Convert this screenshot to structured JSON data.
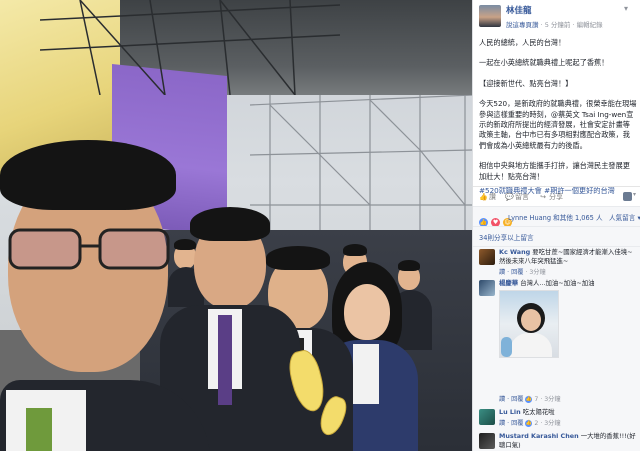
{
  "post": {
    "author": "林佳龍",
    "meta_verified": "說這專頁讚",
    "meta_time": "5 分鐘前",
    "meta_edited": "編輯紀錄",
    "body": [
      "人民的總統，人民的台灣！",
      "",
      "一起在小英總統就職典禮上呢起了香蕉！",
      "",
      "【迎接新世代、點亮台灣！】",
      "",
      "今天520，是新政府的就職典禮，很榮幸能在現場參與這樣重要的時刻，@蔡英文 Tsai Ing-wen宣示的新政府所提出的經濟發展，社會安定計畫等政策主軸，台中市已有多項相對應配合政策，我們會成為小英總統最有力的後盾。",
      "",
      "相信中央與地方能攜手打拚，讓台灣民主發展更加壯大！點亮台灣！"
    ],
    "hashtags": "#520就職典禮大會 #期許一個更好的台灣",
    "actions": {
      "like": "讚",
      "comment": "留言",
      "share": "分享"
    },
    "reactions_text": "Lynne Huang 和其他 1,065 人",
    "sort_label": "人氣留言",
    "more_comments": "34則分享以上留言"
  },
  "comments": [
    {
      "name": "Kc Wang",
      "text": "要吃甘蔗~國家經濟才能漸入佳境~然後未來八年突飛猛進~",
      "actions": "讚 · 回覆",
      "time": "· 3分鐘"
    },
    {
      "name": "楊慶華",
      "text": "台灣人...加油~加油~加油",
      "actions": "讚 · 回覆",
      "likes": "7",
      "time": "· 3分鐘"
    },
    {
      "name": "Lu Lin",
      "text": "吃太陽花啦",
      "actions": "讚 · 回覆",
      "likes": "2",
      "time": "· 3分鐘"
    },
    {
      "name": "Mustard Karashi Chen",
      "text": "一大堆的香蕉!!!(好聰口氣)"
    }
  ],
  "colors": {
    "link": "#365899",
    "meta": "#90949c",
    "text": "#1d2129",
    "like": "#5890ff",
    "love": "#f25268"
  },
  "icons": {
    "like": "thumbs-up-icon",
    "comment": "speech-bubble-icon",
    "share": "share-arrow-icon",
    "menu": "chevron-down-icon"
  }
}
